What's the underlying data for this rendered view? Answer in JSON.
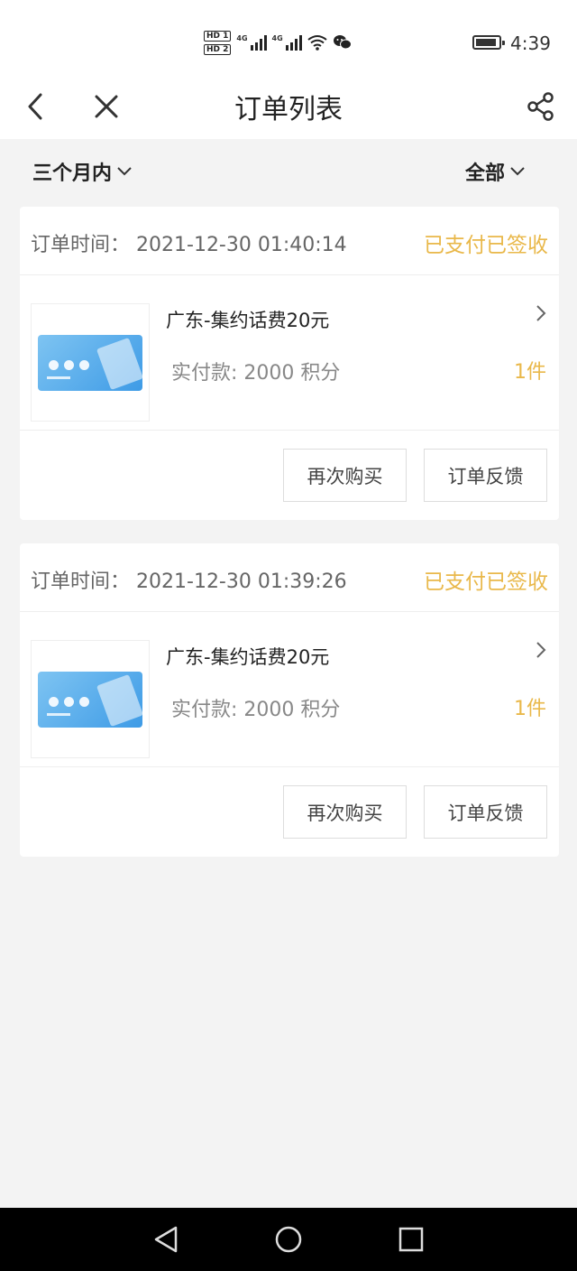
{
  "status_bar": {
    "time": "4:39",
    "sim1": "HD 1",
    "sim2": "HD 2",
    "network1": "4G",
    "network2": "4G",
    "icons": [
      "hd-sim-icon",
      "signal-icon",
      "wifi-icon",
      "wechat-icon",
      "battery-icon"
    ]
  },
  "header": {
    "title": "订单列表",
    "back_icon": "back-icon",
    "close_icon": "close-icon",
    "share_icon": "share-icon"
  },
  "filters": {
    "time_range": "三个月内",
    "status": "全部"
  },
  "colors": {
    "accent": "#e9b84a",
    "background": "#f3f3f3",
    "card": "#ffffff"
  },
  "orders": [
    {
      "time_label": "订单时间：",
      "time_value": "2021-12-30 01:40:14",
      "status": "已支付已签收",
      "product": "广东-集约话费20元",
      "price_label": "实付款: 2000 积分",
      "quantity": "1件",
      "actions": [
        "再次购买",
        "订单反馈"
      ]
    },
    {
      "time_label": "订单时间：",
      "time_value": "2021-12-30 01:39:26",
      "status": "已支付已签收",
      "product": "广东-集约话费20元",
      "price_label": "实付款: 2000 积分",
      "quantity": "1件",
      "actions": [
        "再次购买",
        "订单反馈"
      ]
    }
  ],
  "nav_bar": {
    "icons": [
      "nav-back-icon",
      "nav-home-icon",
      "nav-recent-icon"
    ]
  }
}
